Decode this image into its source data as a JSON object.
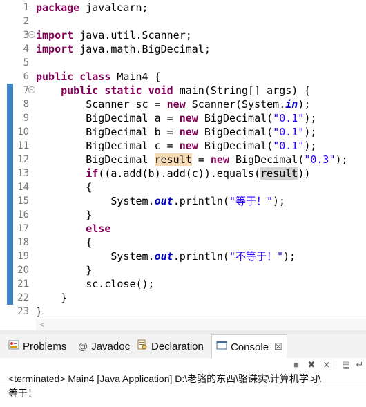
{
  "editor": {
    "lines": [
      {
        "n": "1",
        "fold": false,
        "changed": false,
        "segs": [
          {
            "c": "kw",
            "t": "package"
          },
          {
            "t": " javalearn;"
          }
        ]
      },
      {
        "n": "2",
        "fold": false,
        "changed": false,
        "segs": []
      },
      {
        "n": "3",
        "fold": true,
        "changed": false,
        "segs": [
          {
            "c": "kw",
            "t": "import"
          },
          {
            "t": " java.util.Scanner;"
          }
        ]
      },
      {
        "n": "4",
        "fold": false,
        "changed": false,
        "segs": [
          {
            "c": "kw",
            "t": "import"
          },
          {
            "t": " java.math.BigDecimal;"
          }
        ]
      },
      {
        "n": "5",
        "fold": false,
        "changed": false,
        "segs": []
      },
      {
        "n": "6",
        "fold": false,
        "changed": false,
        "segs": [
          {
            "c": "kw",
            "t": "public"
          },
          {
            "t": " "
          },
          {
            "c": "kw",
            "t": "class"
          },
          {
            "t": " Main4 {"
          }
        ]
      },
      {
        "n": "7",
        "fold": true,
        "changed": true,
        "segs": [
          {
            "t": "    "
          },
          {
            "c": "kw",
            "t": "public"
          },
          {
            "t": " "
          },
          {
            "c": "kw",
            "t": "static"
          },
          {
            "t": " "
          },
          {
            "c": "kw",
            "t": "void"
          },
          {
            "t": " main(String[] args) {"
          }
        ]
      },
      {
        "n": "8",
        "fold": false,
        "changed": true,
        "segs": [
          {
            "t": "        Scanner sc = "
          },
          {
            "c": "kw",
            "t": "new"
          },
          {
            "t": " Scanner(System."
          },
          {
            "c": "fld",
            "t": "in"
          },
          {
            "t": ");"
          }
        ]
      },
      {
        "n": "9",
        "fold": false,
        "changed": true,
        "segs": [
          {
            "t": "        BigDecimal a = "
          },
          {
            "c": "kw",
            "t": "new"
          },
          {
            "t": " BigDecimal("
          },
          {
            "c": "str",
            "t": "\"0.1\""
          },
          {
            "t": ");"
          }
        ]
      },
      {
        "n": "10",
        "fold": false,
        "changed": true,
        "segs": [
          {
            "t": "        BigDecimal b = "
          },
          {
            "c": "kw",
            "t": "new"
          },
          {
            "t": " BigDecimal("
          },
          {
            "c": "str",
            "t": "\"0.1\""
          },
          {
            "t": ");"
          }
        ]
      },
      {
        "n": "11",
        "fold": false,
        "changed": true,
        "segs": [
          {
            "t": "        BigDecimal c = "
          },
          {
            "c": "kw",
            "t": "new"
          },
          {
            "t": " BigDecimal("
          },
          {
            "c": "str",
            "t": "\"0.1\""
          },
          {
            "t": ");"
          }
        ]
      },
      {
        "n": "12",
        "fold": false,
        "changed": true,
        "segs": [
          {
            "t": "        BigDecimal "
          },
          {
            "c": "occ",
            "t": "result"
          },
          {
            "t": " = "
          },
          {
            "c": "kw",
            "t": "new"
          },
          {
            "t": " BigDecimal("
          },
          {
            "c": "str",
            "t": "\"0.3\""
          },
          {
            "t": ");"
          }
        ]
      },
      {
        "n": "13",
        "fold": false,
        "changed": true,
        "segs": [
          {
            "t": "        "
          },
          {
            "c": "kw",
            "t": "if"
          },
          {
            "t": "((a.add(b).add(c)).equals("
          },
          {
            "c": "occr",
            "t": "result"
          },
          {
            "t": "))"
          }
        ]
      },
      {
        "n": "14",
        "fold": false,
        "changed": true,
        "segs": [
          {
            "t": "        {"
          }
        ]
      },
      {
        "n": "15",
        "fold": false,
        "changed": true,
        "segs": [
          {
            "t": "            System."
          },
          {
            "c": "fld",
            "t": "out"
          },
          {
            "t": ".println("
          },
          {
            "c": "str",
            "t": "\"等于！\""
          },
          {
            "t": ");"
          }
        ]
      },
      {
        "n": "16",
        "fold": false,
        "changed": true,
        "segs": [
          {
            "t": "        }"
          }
        ]
      },
      {
        "n": "17",
        "fold": false,
        "changed": true,
        "segs": [
          {
            "t": "        "
          },
          {
            "c": "kw",
            "t": "else"
          }
        ]
      },
      {
        "n": "18",
        "fold": false,
        "changed": true,
        "segs": [
          {
            "t": "        {"
          }
        ]
      },
      {
        "n": "19",
        "fold": false,
        "changed": true,
        "segs": [
          {
            "t": "            System."
          },
          {
            "c": "fld",
            "t": "out"
          },
          {
            "t": ".println("
          },
          {
            "c": "str",
            "t": "\"不等于！\""
          },
          {
            "t": ");"
          }
        ]
      },
      {
        "n": "20",
        "fold": false,
        "changed": true,
        "segs": [
          {
            "t": "        }"
          }
        ]
      },
      {
        "n": "21",
        "fold": false,
        "changed": true,
        "segs": [
          {
            "t": "        sc.close();"
          }
        ]
      },
      {
        "n": "22",
        "fold": false,
        "changed": true,
        "segs": [
          {
            "t": "    }"
          }
        ]
      },
      {
        "n": "23",
        "fold": false,
        "changed": false,
        "segs": [
          {
            "t": "}"
          }
        ]
      }
    ]
  },
  "views": {
    "problems_label": "Problems",
    "javadoc_label": "Javadoc",
    "declaration_label": "Declaration",
    "console_label": "Console",
    "javadoc_symbol": "@"
  },
  "console": {
    "title": "<terminated> Main4 [Java Application] D:\\老骆的东西\\骆谦实\\计算机学习\\",
    "output": "等于！"
  }
}
